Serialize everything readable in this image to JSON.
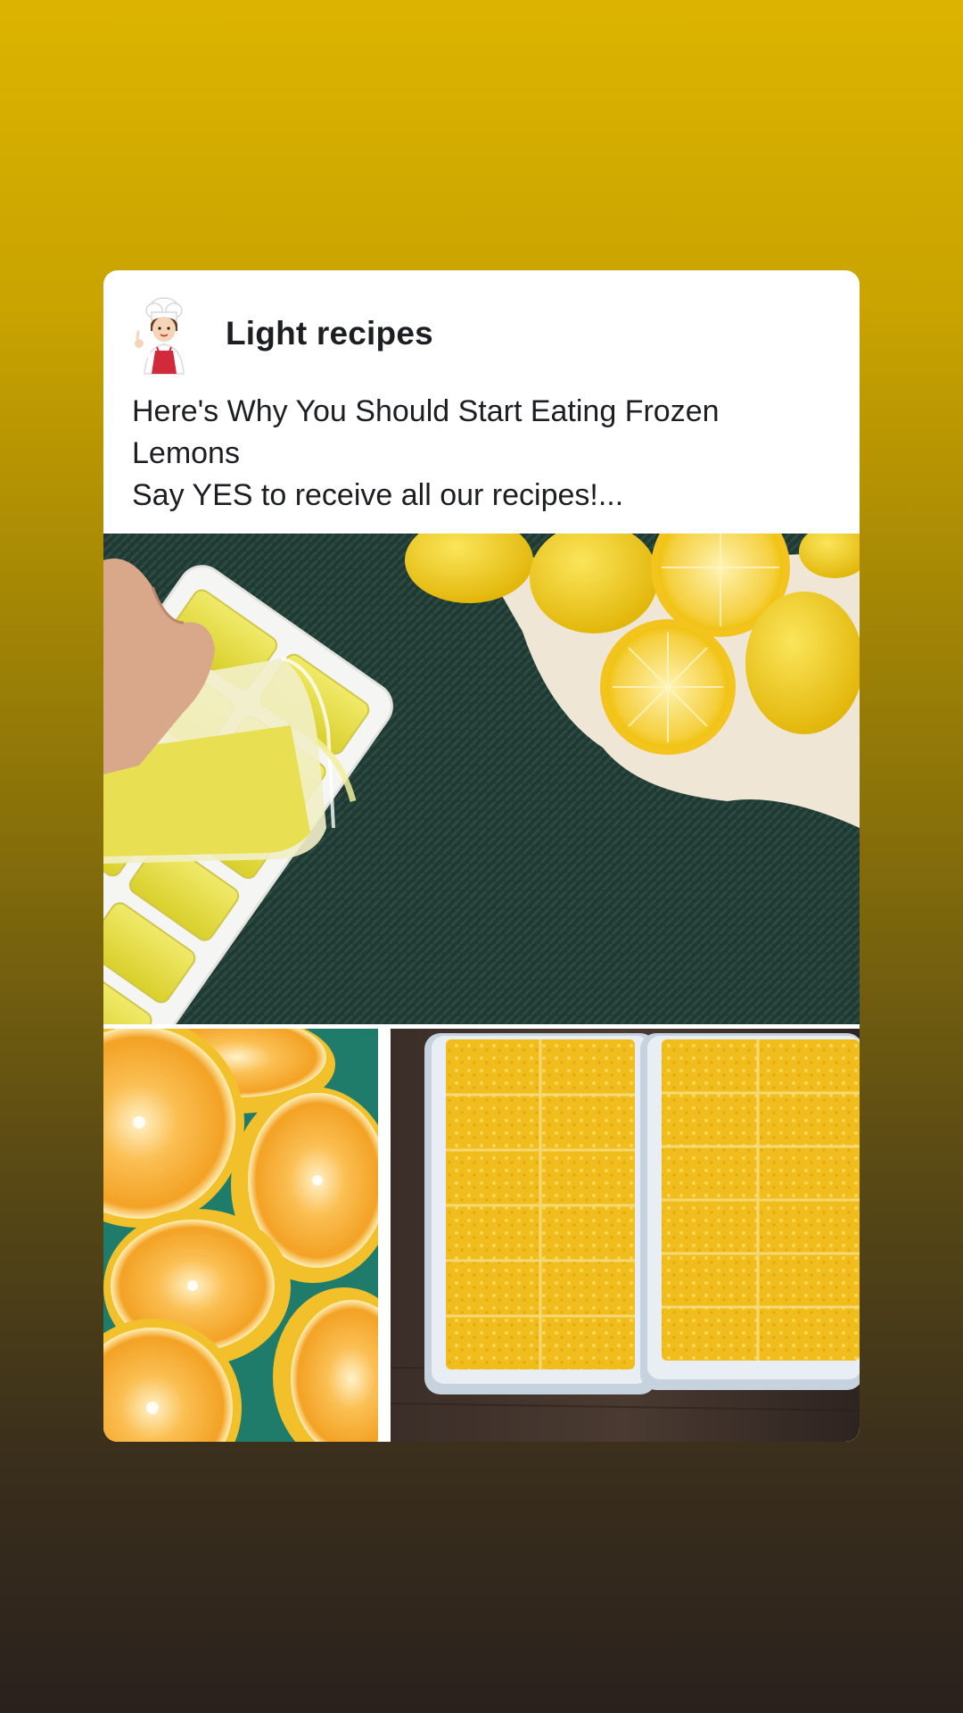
{
  "post": {
    "author": "Light recipes",
    "avatar_icon": "chef-avatar-icon",
    "caption_lines": [
      "Here's Why You Should Start Eating Frozen",
      "Lemons",
      "Say YES to receive all our recipes!..."
    ]
  },
  "colors": {
    "background_top": "#dcb400",
    "background_bottom": "#2a211d",
    "card": "#ffffff",
    "text": "#1c1e21",
    "lemon": "#f2cf1d",
    "lemon_juice": "#e6e04a"
  }
}
